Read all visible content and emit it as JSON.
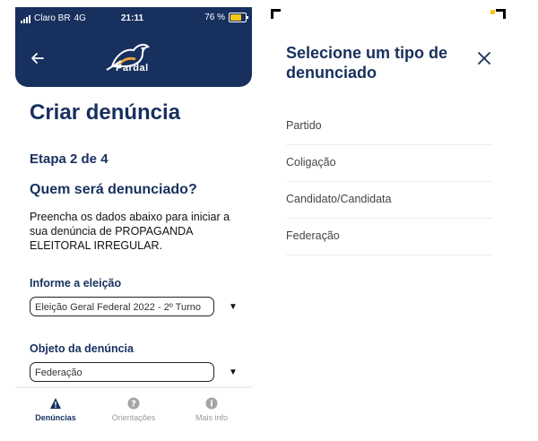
{
  "left": {
    "status": {
      "carrier": "Claro BR",
      "network": "4G",
      "time": "21:11",
      "battery": "76 %"
    },
    "header": {
      "back_icon": "arrow-left-icon",
      "logo_text": "Pardal"
    },
    "page_title": "Criar denúncia",
    "step": "Etapa 2 de 4",
    "question": "Quem será denunciado?",
    "description": "Preencha os dados abaixo para iniciar a sua denúncia de PROPAGANDA ELEITORAL IRREGULAR.",
    "election": {
      "label": "Informe a eleição",
      "value": "Eleição Geral Federal 2022 - 2º Turno"
    },
    "object": {
      "label": "Objeto da denúncia",
      "value": "Federação"
    },
    "tabs": [
      {
        "label": "Denúncias",
        "icon": "warning-icon",
        "active": true
      },
      {
        "label": "Orientações",
        "icon": "help-icon",
        "active": false
      },
      {
        "label": "Mais info",
        "icon": "info-icon",
        "active": false
      }
    ],
    "colors": {
      "primary": "#17305e",
      "battery": "#f5c518"
    }
  },
  "right": {
    "modal_title": "Selecione um tipo de denunciado",
    "close_icon": "close-icon",
    "options": [
      {
        "label": "Partido"
      },
      {
        "label": "Coligação"
      },
      {
        "label": "Candidato/Candidata"
      },
      {
        "label": "Federação"
      }
    ]
  }
}
